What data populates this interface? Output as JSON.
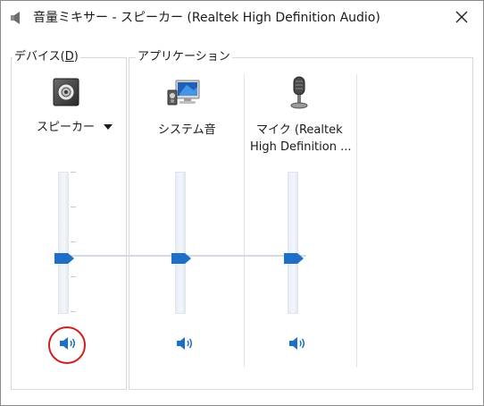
{
  "window": {
    "title": "音量ミキサー - スピーカー (Realtek High Definition Audio)"
  },
  "device": {
    "group_label_prefix": "デバイス(",
    "group_label_key": "D",
    "group_label_suffix": ")",
    "name": "スピーカー",
    "icon": "speaker-device-icon",
    "mute_icon": "speaker-volume-icon",
    "highlight_color": "#d21f1f"
  },
  "applications": {
    "group_label": "アプリケーション",
    "items": [
      {
        "name_line1": "システム音",
        "name_line2": "",
        "icon": "system-sounds-icon",
        "mute_icon": "speaker-volume-icon"
      },
      {
        "name_line1": "マイク (Realtek",
        "name_line2": "High Definition ...",
        "icon": "microphone-icon",
        "mute_icon": "speaker-volume-icon"
      }
    ]
  },
  "colors": {
    "accent": "#1e6fc8",
    "border": "#d9d9d9"
  }
}
